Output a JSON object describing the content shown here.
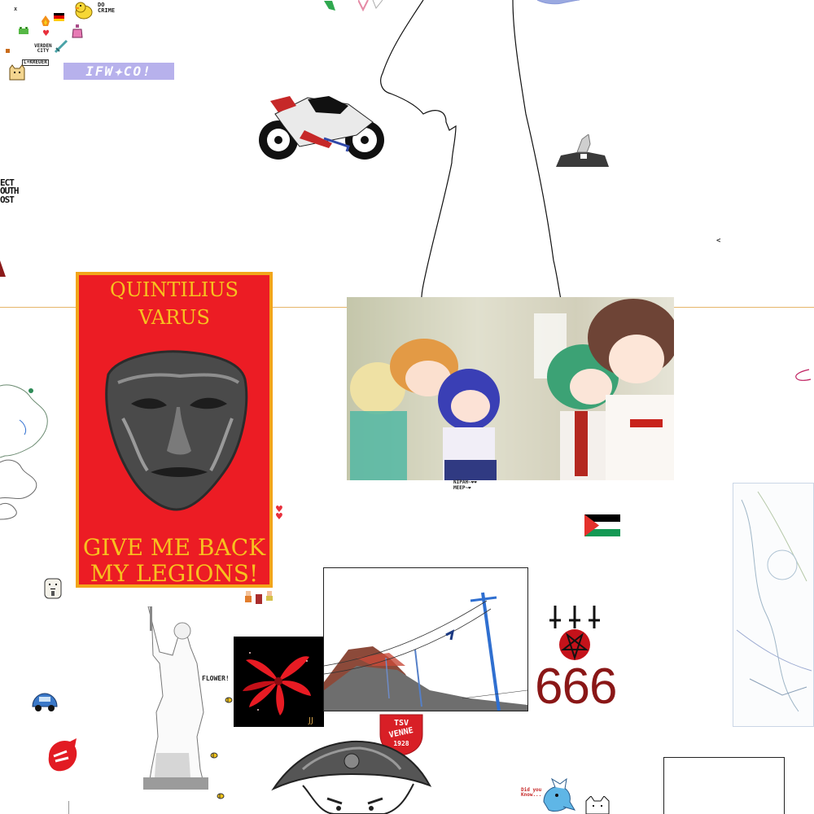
{
  "canvas": {
    "background": "#ffffff",
    "divider_color": "#e6b56a"
  },
  "poster": {
    "title_line1": "QUINTILIUS",
    "title_line2": "VARUS",
    "bottom_line1": "GIVE ME BACK",
    "bottom_line2": "MY LEGIONS!",
    "bg_color": "#ec1c24",
    "border_color": "#f2a51a",
    "text_color": "#f7c11f"
  },
  "top_left": {
    "do_crime": "DO\nCRIME",
    "verden_city": "VERDEN\nCITY",
    "love_label": "L+KREUER",
    "ifw_banner": "IFW✦CO!"
  },
  "left_fragment": {
    "text": "ECT\nOUTH\nOST"
  },
  "anime_art": {
    "caption_line1": "NIPAH~❤❤",
    "caption_line2": "MEEP~❤"
  },
  "flower_label": "FLOWER!",
  "satanic": {
    "number": "666"
  },
  "tsv_badge": {
    "line1": "TSV",
    "line2": "VENNE",
    "line3": "1928"
  },
  "did_you_know": "Did you\nKnow...",
  "lone_chevron": "<",
  "icons": [
    "duck-icon",
    "german-flag-icon",
    "palestine-flag-icon",
    "motorcycle-icon",
    "sword-icon",
    "cat-icon",
    "beetle-car-icon",
    "bee-icon",
    "pentagram-icon",
    "inverted-cross-icon",
    "heart-icon"
  ]
}
